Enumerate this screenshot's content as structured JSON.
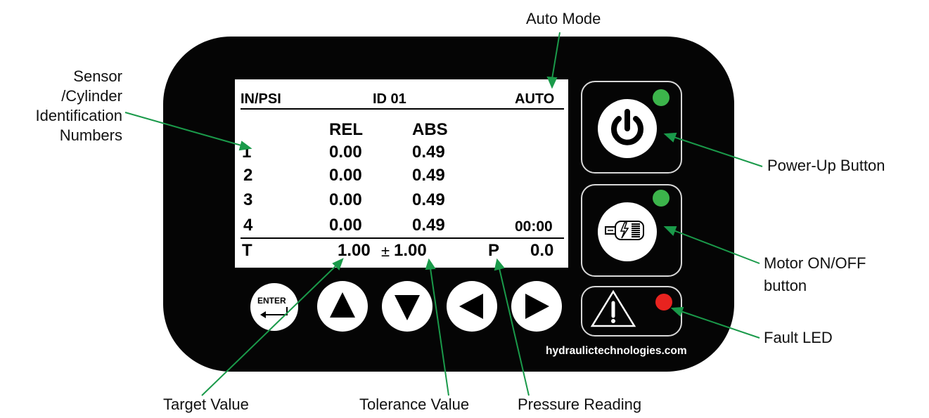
{
  "callouts": {
    "auto_mode": "Auto Mode",
    "sensor_id_line1": "Sensor",
    "sensor_id_line2": "/Cylinder",
    "sensor_id_line3": "Identification",
    "sensor_id_line4": "Numbers",
    "power_up": "Power-Up Button",
    "motor_line1": "Motor ON/OFF",
    "motor_line2": "button",
    "fault_led": "Fault LED",
    "target_value": "Target Value",
    "tolerance_value": "Tolerance Value",
    "pressure_reading": "Pressure Reading"
  },
  "screen": {
    "units": "IN/PSI",
    "id": "ID 01",
    "mode": "AUTO",
    "col_rel": "REL",
    "col_abs": "ABS",
    "rows": [
      {
        "num": "1",
        "rel": "0.00",
        "abs": "0.49"
      },
      {
        "num": "2",
        "rel": "0.00",
        "abs": "0.49"
      },
      {
        "num": "3",
        "rel": "0.00",
        "abs": "0.49"
      },
      {
        "num": "4",
        "rel": "0.00",
        "abs": "0.49"
      }
    ],
    "timer": "00:00",
    "target_label": "T",
    "target": "1.00",
    "plusminus": "±",
    "tolerance": "1.00",
    "pressure_label": "P",
    "pressure": "0.0"
  },
  "buttons": {
    "enter": "ENTER"
  },
  "brand": "hydraulictechnologies.com",
  "colors": {
    "callout_line": "#1a9a4a",
    "power_led": "#3cb44b",
    "motor_led": "#3cb44b",
    "fault_led": "#e8231f",
    "panel": "#050505"
  },
  "icons": {
    "power": "power-icon",
    "motor": "motor-icon",
    "fault": "warning-triangle-icon",
    "enter": "enter-return-icon",
    "up": "arrow-up-icon",
    "down": "arrow-down-icon",
    "left": "arrow-left-icon",
    "right": "arrow-right-icon"
  }
}
